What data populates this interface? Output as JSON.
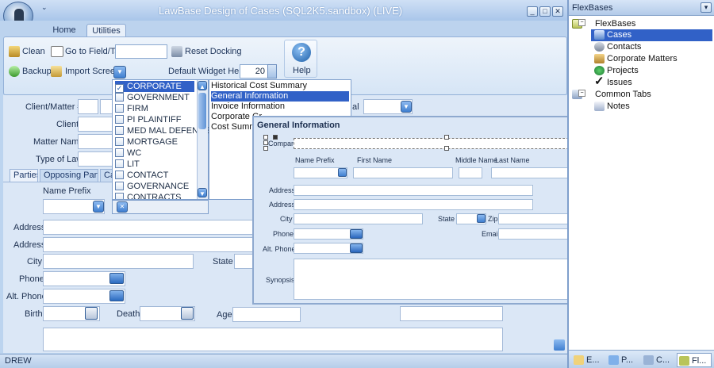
{
  "window": {
    "title": "LawBase Design of Cases (SQL2K5.sandbox) (LIVE)"
  },
  "tabs": [
    {
      "label": "Home"
    },
    {
      "label": "Utilities"
    }
  ],
  "ribbon": {
    "clean": "Clean",
    "backup": "Backup",
    "goto_field": "Go to Field/Tab",
    "import_screen": "Import Screen",
    "reset_docking": "Reset Docking",
    "widget_height_label": "Default Widget Height",
    "widget_height_value": "20",
    "help": "Help"
  },
  "form": {
    "client_matter": "Client/Matter #",
    "client": "Client",
    "matter_name": "Matter Name",
    "type_of_law": "Type of Law",
    "partial_label": "al",
    "tabs": [
      "Parties",
      "Opposing Party",
      "Ca"
    ],
    "name_prefix": "Name Prefix",
    "address1": "Address",
    "address2": "Address",
    "city": "City",
    "state": "State",
    "phone": "Phone",
    "alt_phone": "Alt. Phone",
    "birth": "Birth",
    "death": "Death",
    "age": "Age"
  },
  "status": {
    "user": "DREW"
  },
  "checklist": {
    "items": [
      "CORPORATE",
      "GOVERNMENT",
      "FIRM",
      "PI PLAINTIFF",
      "MED MAL DEFENSE",
      "MORTGAGE",
      "WC",
      "LIT",
      "CONTACT",
      "GOVERNANCE",
      "CONTRACTS"
    ],
    "selected_index": 0
  },
  "screens": {
    "items": [
      "Historical Cost Summary",
      "General Information",
      "Invoice Information",
      "Corporate Gr",
      "Cost Summar"
    ],
    "selected_index": 1
  },
  "general_info": {
    "title": "General Information",
    "company": "Company",
    "name_prefix": "Name Prefix",
    "first_name": "First Name",
    "middle_name": "Middle Name",
    "last_name": "Last Name",
    "address1": "Address",
    "address2": "Address",
    "city": "City",
    "state": "State",
    "zip": "Zip",
    "phone": "Phone",
    "email": "Email",
    "alt_phone": "Alt. Phone",
    "synopsis": "Synopsis"
  },
  "side_panel": {
    "title": "FlexBases",
    "tree": [
      {
        "label": "FlexBases",
        "icon": "flexbases-icon",
        "level": 0
      },
      {
        "label": "Cases",
        "icon": "cases-icon",
        "level": 1,
        "selected": true
      },
      {
        "label": "Contacts",
        "icon": "contacts-icon",
        "level": 1
      },
      {
        "label": "Corporate Matters",
        "icon": "corporate-matters-icon",
        "level": 1
      },
      {
        "label": "Projects",
        "icon": "projects-icon",
        "level": 1
      },
      {
        "label": "Issues",
        "icon": "issues-icon",
        "level": 1
      },
      {
        "label": "Common Tabs",
        "icon": "common-tabs-icon",
        "level": 0
      },
      {
        "label": "Notes",
        "icon": "notes-icon",
        "level": 1
      }
    ],
    "footer_tabs": [
      "E...",
      "P...",
      "C...",
      "Fl..."
    ]
  },
  "colors": {
    "selection": "#3161c7",
    "accent": "#2b6bc0"
  }
}
